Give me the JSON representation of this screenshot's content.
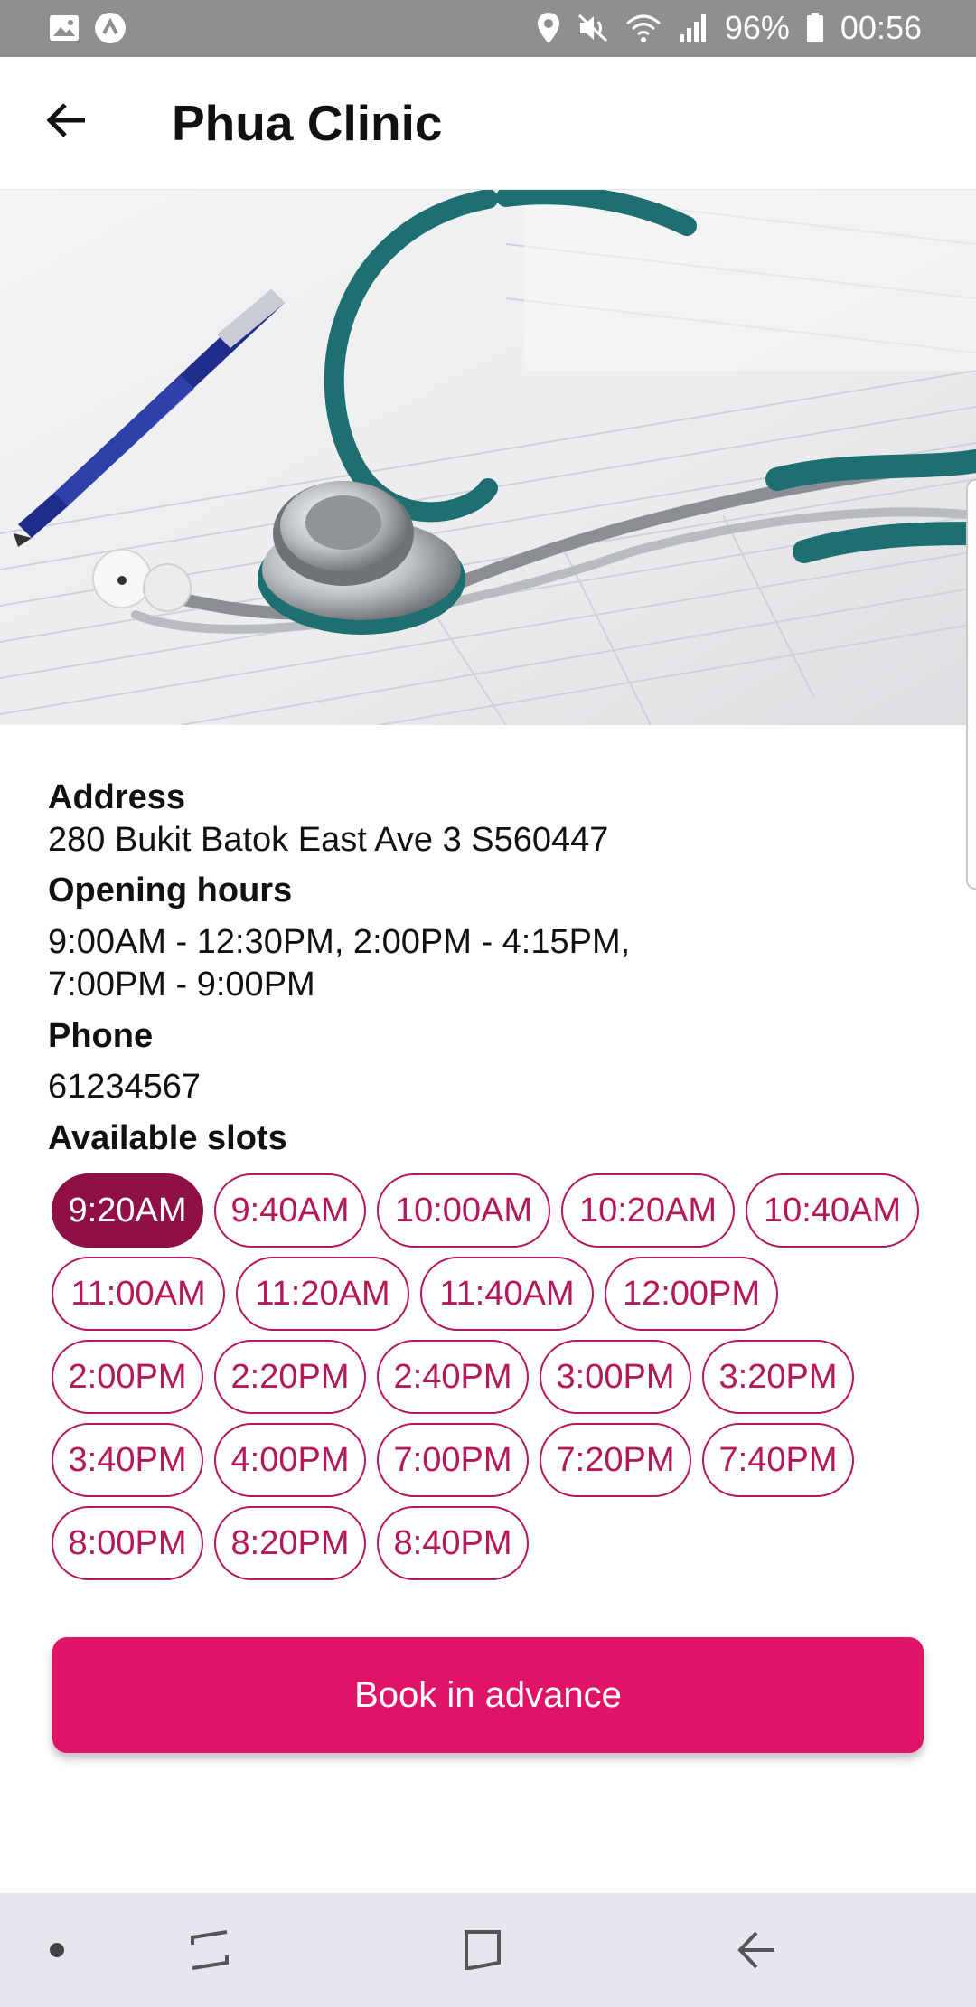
{
  "status_bar": {
    "battery": "96%",
    "time": "00:56",
    "icons": [
      "gallery-icon",
      "app-notification-icon",
      "location-icon",
      "mute-icon",
      "wifi-icon",
      "signal-icon",
      "battery-icon"
    ]
  },
  "header": {
    "title": "Phua Clinic",
    "back_icon": "arrow-left-icon"
  },
  "hero": {
    "image": "stethoscope-and-pen-on-paper"
  },
  "details": {
    "address_label": "Address",
    "address_value": "280 Bukit Batok East Ave 3 S560447",
    "hours_label": "Opening hours",
    "hours_line1": "9:00AM - 12:30PM, 2:00PM - 4:15PM,",
    "hours_line2": "7:00PM - 9:00PM",
    "phone_label": "Phone",
    "phone_value": "61234567",
    "slots_label": "Available slots"
  },
  "slots": {
    "selected": "9:20AM",
    "rows": [
      [
        "9:20AM",
        "9:40AM",
        "10:00AM",
        "10:20AM",
        "10:40AM"
      ],
      [
        "11:00AM",
        "11:20AM",
        "11:40AM",
        "12:00PM"
      ],
      [
        "2:00PM",
        "2:20PM",
        "2:40PM",
        "3:00PM",
        "3:20PM"
      ],
      [
        "3:40PM",
        "4:00PM",
        "7:00PM",
        "7:20PM",
        "7:40PM"
      ],
      [
        "8:00PM",
        "8:20PM",
        "8:40PM"
      ]
    ]
  },
  "actions": {
    "book_label": "Book in advance"
  },
  "colors": {
    "accent": "#df1466",
    "slot_outline": "#b4175a",
    "slot_selected": "#8e1046",
    "status_bar": "#8f8f8f",
    "nav_bar": "#e5e6ee"
  },
  "nav_bar": {
    "icons": [
      "dot-icon",
      "recent-apps-icon",
      "home-icon",
      "back-icon"
    ]
  }
}
